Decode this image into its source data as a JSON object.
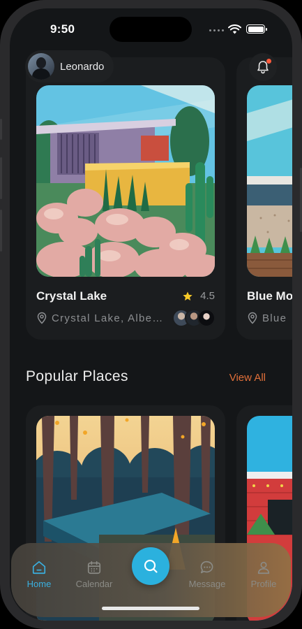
{
  "status": {
    "time": "9:50"
  },
  "header": {
    "username": "Leonardo"
  },
  "featured": [
    {
      "title": "Crystal Lake",
      "rating": "4.5",
      "location": "Crystal Lake, Albe…"
    },
    {
      "title": "Blue Mo",
      "location": "Blue"
    }
  ],
  "popular": {
    "title": "Popular Places",
    "view_all": "View All"
  },
  "nav": {
    "home": "Home",
    "calendar": "Calendar",
    "message": "Message",
    "profile": "Profile"
  },
  "colors": {
    "accent": "#2bb1de",
    "link": "#e2703a",
    "background": "#141618",
    "card": "#1b1d1f"
  },
  "icons": [
    "wifi-icon",
    "battery-icon",
    "bell-icon",
    "star-icon",
    "location-pin-icon",
    "home-icon",
    "calendar-icon",
    "search-icon",
    "message-icon",
    "profile-icon"
  ]
}
